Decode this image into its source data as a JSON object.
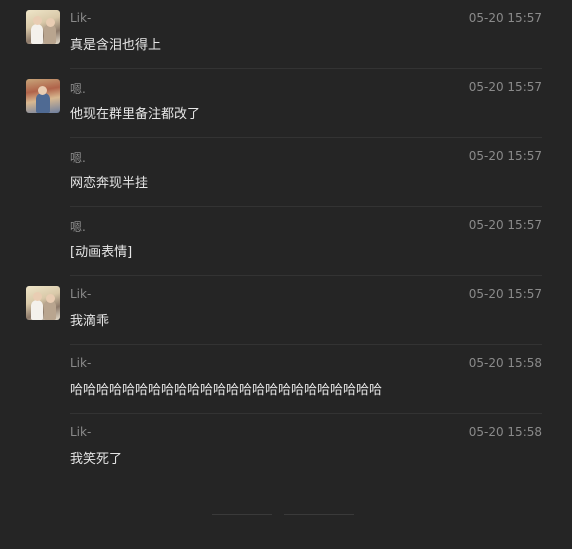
{
  "messages": [
    {
      "sender": "Lik-",
      "time": "05-20 15:57",
      "text": "真是含泪也得上",
      "avatar": "lik"
    },
    {
      "sender": "嗯.",
      "time": "05-20 15:57",
      "text": "他现在群里备注都改了",
      "avatar": "en"
    },
    {
      "sender": "嗯.",
      "time": "05-20 15:57",
      "text": "网恋奔现半挂",
      "avatar": ""
    },
    {
      "sender": "嗯.",
      "time": "05-20 15:57",
      "text": "[动画表情]",
      "avatar": ""
    },
    {
      "sender": "Lik-",
      "time": "05-20 15:57",
      "text": "我滴乖",
      "avatar": "lik"
    },
    {
      "sender": "Lik-",
      "time": "05-20 15:58",
      "text": "哈哈哈哈哈哈哈哈哈哈哈哈哈哈哈哈哈哈哈哈哈哈哈哈",
      "avatar": ""
    },
    {
      "sender": "Lik-",
      "time": "05-20 15:58",
      "text": "我笑死了",
      "avatar": ""
    }
  ]
}
